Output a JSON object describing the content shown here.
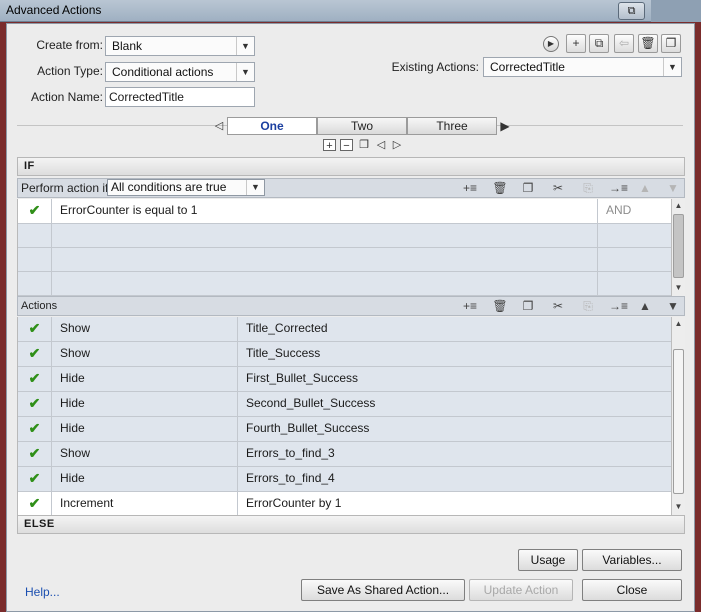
{
  "window": {
    "title": "Advanced Actions",
    "restore_icon": "⧉"
  },
  "form": {
    "create_from_label": "Create from:",
    "create_from_value": "Blank",
    "action_type_label": "Action Type:",
    "action_type_value": "Conditional actions",
    "action_name_label": "Action Name:",
    "action_name_value": "CorrectedTitle",
    "existing_actions_label": "Existing Actions:",
    "existing_actions_value": "CorrectedTitle"
  },
  "toolbar_icons": {
    "preview": "▶",
    "add": "+",
    "duplicate": "⧉",
    "import": "⇦",
    "delete": "🗑",
    "copy": "❐"
  },
  "tabs": [
    {
      "label": "One",
      "active": true
    },
    {
      "label": "Two",
      "active": false
    },
    {
      "label": "Three",
      "active": false
    }
  ],
  "tab_controls": {
    "add": "+",
    "remove": "−",
    "copy": "❐",
    "prev": "◁",
    "next": "▷",
    "play": "▶",
    "scroll_left": "◁"
  },
  "if_section": {
    "header": "IF",
    "perform_label": "Perform action if:",
    "condition_mode": "All conditions are true",
    "toolbar": {
      "insert": "+≡",
      "delete": "🗑",
      "copy": "❐",
      "cut": "✂",
      "paste": "⎘",
      "indent": "→≡",
      "up": "▲",
      "down": "▼"
    },
    "conditions": [
      {
        "checked": true,
        "text": "ErrorCounter     is equal to     1",
        "op": "AND"
      },
      {
        "checked": false,
        "text": "",
        "op": ""
      },
      {
        "checked": false,
        "text": "",
        "op": ""
      },
      {
        "checked": false,
        "text": "",
        "op": ""
      }
    ]
  },
  "actions_section": {
    "header": "Actions",
    "rows": [
      {
        "checked": true,
        "action": "Show",
        "target": "Title_Corrected"
      },
      {
        "checked": true,
        "action": "Show",
        "target": "Title_Success"
      },
      {
        "checked": true,
        "action": "Hide",
        "target": "First_Bullet_Success"
      },
      {
        "checked": true,
        "action": "Hide",
        "target": "Second_Bullet_Success"
      },
      {
        "checked": true,
        "action": "Hide",
        "target": "Fourth_Bullet_Success"
      },
      {
        "checked": true,
        "action": "Show",
        "target": "Errors_to_find_3"
      },
      {
        "checked": true,
        "action": "Hide",
        "target": "Errors_to_find_4"
      },
      {
        "checked": true,
        "action": "Increment",
        "target": "ErrorCounter     by     1"
      }
    ]
  },
  "else_section": {
    "header": "ELSE"
  },
  "buttons": {
    "usage": "Usage",
    "variables": "Variables...",
    "save_shared": "Save As Shared Action...",
    "update": "Update Action",
    "close": "Close",
    "help": "Help..."
  },
  "colors": {
    "accent": "#1b3fa0",
    "check": "#2f8f18",
    "row_bg": "#dfe5ed"
  }
}
